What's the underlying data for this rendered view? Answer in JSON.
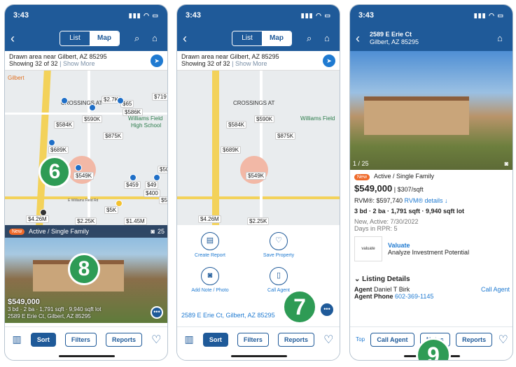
{
  "status_time": "3:43",
  "screen1": {
    "seg_list": "List",
    "seg_map": "Map",
    "info_line1": "Drawn area near Gilbert, AZ 85295",
    "info_showing": "Showing 32 of 32",
    "info_more": "Show More",
    "prices": [
      "$719",
      "$2.7K",
      "$65",
      "$586K",
      "$590K",
      "$584K",
      "$875K",
      "$689K",
      "$549K",
      "$459",
      "$49",
      "$400",
      "$54",
      "$500",
      "$5K",
      "$4.26M",
      "$2.25K",
      "$1.45M"
    ],
    "map_labels": [
      "CROSSINGS AT",
      "Williams Field",
      "High School",
      "Gilbert"
    ],
    "street": "E Williams Field Rd",
    "card_status": "Active / Single Family",
    "card_new": "New",
    "card_photos": "25",
    "card_price": "$549,000",
    "card_specs": "3 bd · 2 ba · 1,791 sqft · 9,940 sqft lot",
    "card_address": "2589 E Erie Ct, Gilbert, AZ 85295",
    "callout6": "6",
    "callout8": "8"
  },
  "tabbar": {
    "sort": "Sort",
    "filters": "Filters",
    "reports": "Reports"
  },
  "screen2": {
    "actions": [
      "Create Report",
      "Save Property",
      "Add Note / Photo",
      "Call Agent"
    ],
    "address": "2589 E Erie Ct, Gilbert, AZ 85295",
    "callout7": "7"
  },
  "screen3": {
    "title": "2589 E Erie Ct",
    "subtitle": "Gilbert, AZ 85295",
    "photo_count": "1 / 25",
    "status": "Active / Single Family",
    "new": "New",
    "price": "$549,000",
    "ppsf": "| $307/sqft",
    "rvm": "RVM®: $597,740",
    "rvm_details": "RVM® details",
    "specs": "3 bd · 2 ba · 1,791 sqft · 9,940 sqft lot",
    "new_active": "New, Active: 7/30/2022",
    "days": "Days in RPR: 5",
    "valuate_title": "Valuate",
    "valuate_desc": "Analyze Investment Potential",
    "valuate_logo": "valuate",
    "listing_details": "Listing Details",
    "agent_label": "Agent",
    "agent_name": "Daniel T Birk",
    "call_agent_link": "Call Agent",
    "agent_phone_label": "Agent Phone",
    "agent_phone": "602-369-1145",
    "top": "Top",
    "btn_call": "Call Agent",
    "btn_notes": "Notes",
    "btn_reports": "Reports",
    "callout9": "9"
  }
}
